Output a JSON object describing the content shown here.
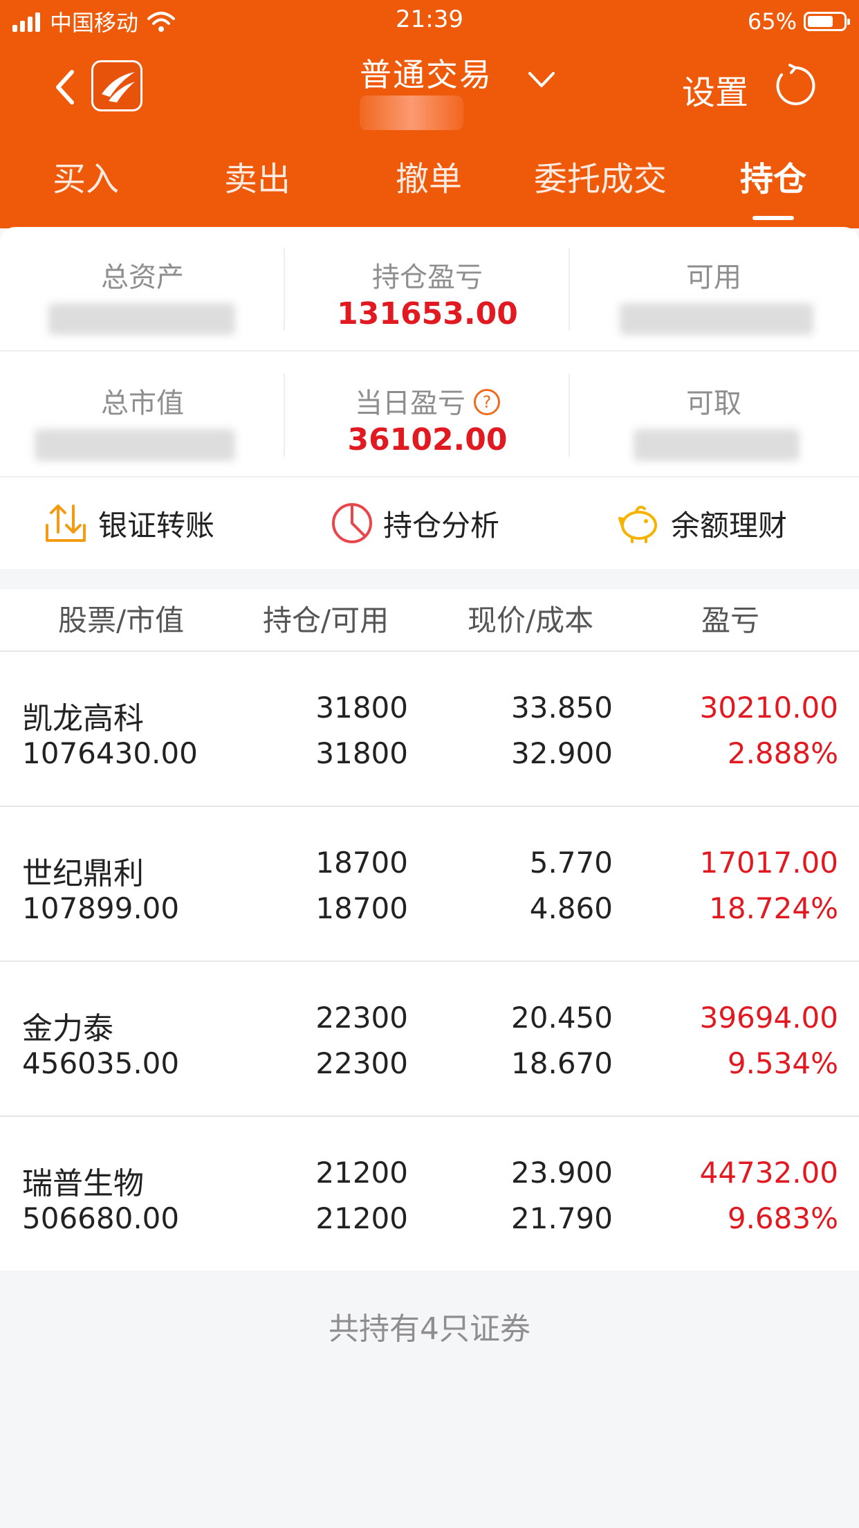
{
  "status_bar": {
    "carrier": "中国移动",
    "time": "21:39",
    "battery": "65%"
  },
  "header": {
    "title": "普通交易",
    "settings_label": "设置"
  },
  "tabs": [
    {
      "label": "买入"
    },
    {
      "label": "卖出"
    },
    {
      "label": "撤单"
    },
    {
      "label": "委托成交"
    },
    {
      "label": "持仓"
    }
  ],
  "summary": {
    "total_assets": {
      "label": "总资产",
      "value": ""
    },
    "position_pl": {
      "label": "持仓盈亏",
      "value": "131653.00"
    },
    "available": {
      "label": "可用",
      "value": ""
    },
    "market_value": {
      "label": "总市值",
      "value": ""
    },
    "daily_pl": {
      "label": "当日盈亏",
      "value": "36102.00",
      "help": "?"
    },
    "withdrawable": {
      "label": "可取",
      "value": ""
    }
  },
  "actions": [
    {
      "label": "银证转账",
      "icon": "transfer-icon"
    },
    {
      "label": "持仓分析",
      "icon": "pie-chart-icon"
    },
    {
      "label": "余额理财",
      "icon": "piggy-bank-icon"
    }
  ],
  "table": {
    "headers": [
      "股票/市值",
      "持仓/可用",
      "现价/成本",
      "盈亏"
    ],
    "rows": [
      {
        "name": "凯龙高科",
        "market_value": "1076430.00",
        "holding": "31800",
        "available": "31800",
        "price": "33.850",
        "cost": "32.900",
        "pl": "30210.00",
        "pl_pct": "2.888%"
      },
      {
        "name": "世纪鼎利",
        "market_value": "107899.00",
        "holding": "18700",
        "available": "18700",
        "price": "5.770",
        "cost": "4.860",
        "pl": "17017.00",
        "pl_pct": "18.724%"
      },
      {
        "name": "金力泰",
        "market_value": "456035.00",
        "holding": "22300",
        "available": "22300",
        "price": "20.450",
        "cost": "18.670",
        "pl": "39694.00",
        "pl_pct": "9.534%"
      },
      {
        "name": "瑞普生物",
        "market_value": "506680.00",
        "holding": "21200",
        "available": "21200",
        "price": "23.900",
        "cost": "21.790",
        "pl": "44732.00",
        "pl_pct": "9.683%"
      }
    ]
  },
  "footer": {
    "text": "共持有4只证券"
  },
  "colors": {
    "brand": "#ee5a0a",
    "profit": "#e11a22",
    "accent_icon": "#f39c12"
  }
}
